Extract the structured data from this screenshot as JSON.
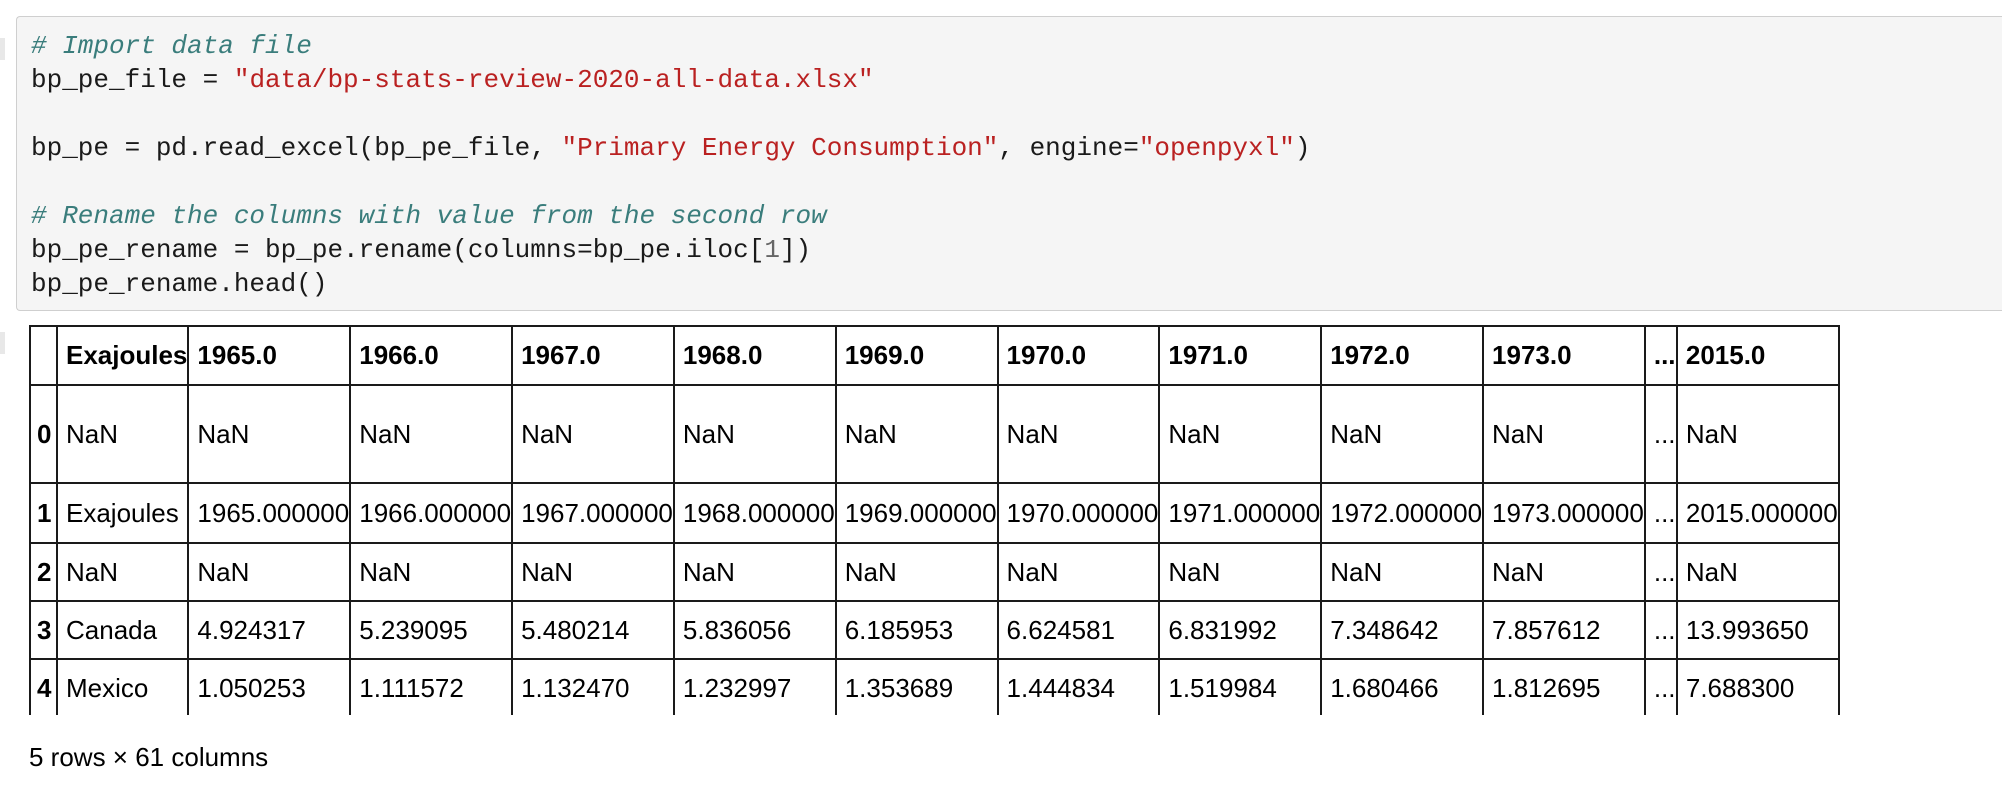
{
  "code_cell": {
    "lines": [
      "# Import data file",
      "bp_pe_file = \"data/bp-stats-review-2020-all-data.xlsx\"",
      "",
      "bp_pe = pd.read_excel(bp_pe_file, \"Primary Energy Consumption\", engine=\"openpyxl\")",
      "",
      "# Rename the columns with value from the second row",
      "bp_pe_rename = bp_pe.rename(columns=bp_pe.iloc[1])",
      "bp_pe_rename.head()"
    ],
    "tokens": {
      "comment_import": "# Import data file",
      "var_file": "bp_pe_file = ",
      "str_file": "\"data/bp-stats-review-2020-all-data.xlsx\"",
      "read_prefix": "bp_pe = pd.read_excel(bp_pe_file, ",
      "str_sheet": "\"Primary Energy Consumption\"",
      "engine_kw": ", engine=",
      "str_engine": "\"openpyxl\"",
      "close_paren": ")",
      "comment_rename": "# Rename the columns with value from the second row",
      "rename_prefix": "bp_pe_rename = bp_pe.rename(columns=bp_pe.iloc[",
      "rename_num": "1",
      "rename_suffix": "])",
      "head_call": "bp_pe_rename.head()"
    }
  },
  "dataframe": {
    "columns": [
      "",
      "Exajoules",
      "1965.0",
      "1966.0",
      "1967.0",
      "1968.0",
      "1969.0",
      "1970.0",
      "1971.0",
      "1972.0",
      "1973.0",
      "...",
      "2015.0"
    ],
    "rows": [
      {
        "index": "0",
        "cells": [
          "NaN",
          "NaN",
          "NaN",
          "NaN",
          "NaN",
          "NaN",
          "NaN",
          "NaN",
          "NaN",
          "NaN",
          "...",
          "NaN"
        ]
      },
      {
        "index": "1",
        "cells": [
          "Exajoules",
          "1965.000000",
          "1966.000000",
          "1967.000000",
          "1968.000000",
          "1969.000000",
          "1970.000000",
          "1971.000000",
          "1972.000000",
          "1973.000000",
          "...",
          "2015.000000"
        ]
      },
      {
        "index": "2",
        "cells": [
          "NaN",
          "NaN",
          "NaN",
          "NaN",
          "NaN",
          "NaN",
          "NaN",
          "NaN",
          "NaN",
          "NaN",
          "...",
          "NaN"
        ]
      },
      {
        "index": "3",
        "cells": [
          "Canada",
          "4.924317",
          "5.239095",
          "5.480214",
          "5.836056",
          "6.185953",
          "6.624581",
          "6.831992",
          "7.348642",
          "7.857612",
          "...",
          "13.993650"
        ]
      },
      {
        "index": "4",
        "cells": [
          "Mexico",
          "1.050253",
          "1.111572",
          "1.132470",
          "1.232997",
          "1.353689",
          "1.444834",
          "1.519984",
          "1.680466",
          "1.812695",
          "...",
          "7.688300"
        ]
      }
    ],
    "shape_note": "5 rows × 61 columns"
  },
  "colors": {
    "code_background": "#f5f5f5",
    "comment": "#3a7d7c",
    "string": "#ba2121",
    "number": "#666666"
  }
}
